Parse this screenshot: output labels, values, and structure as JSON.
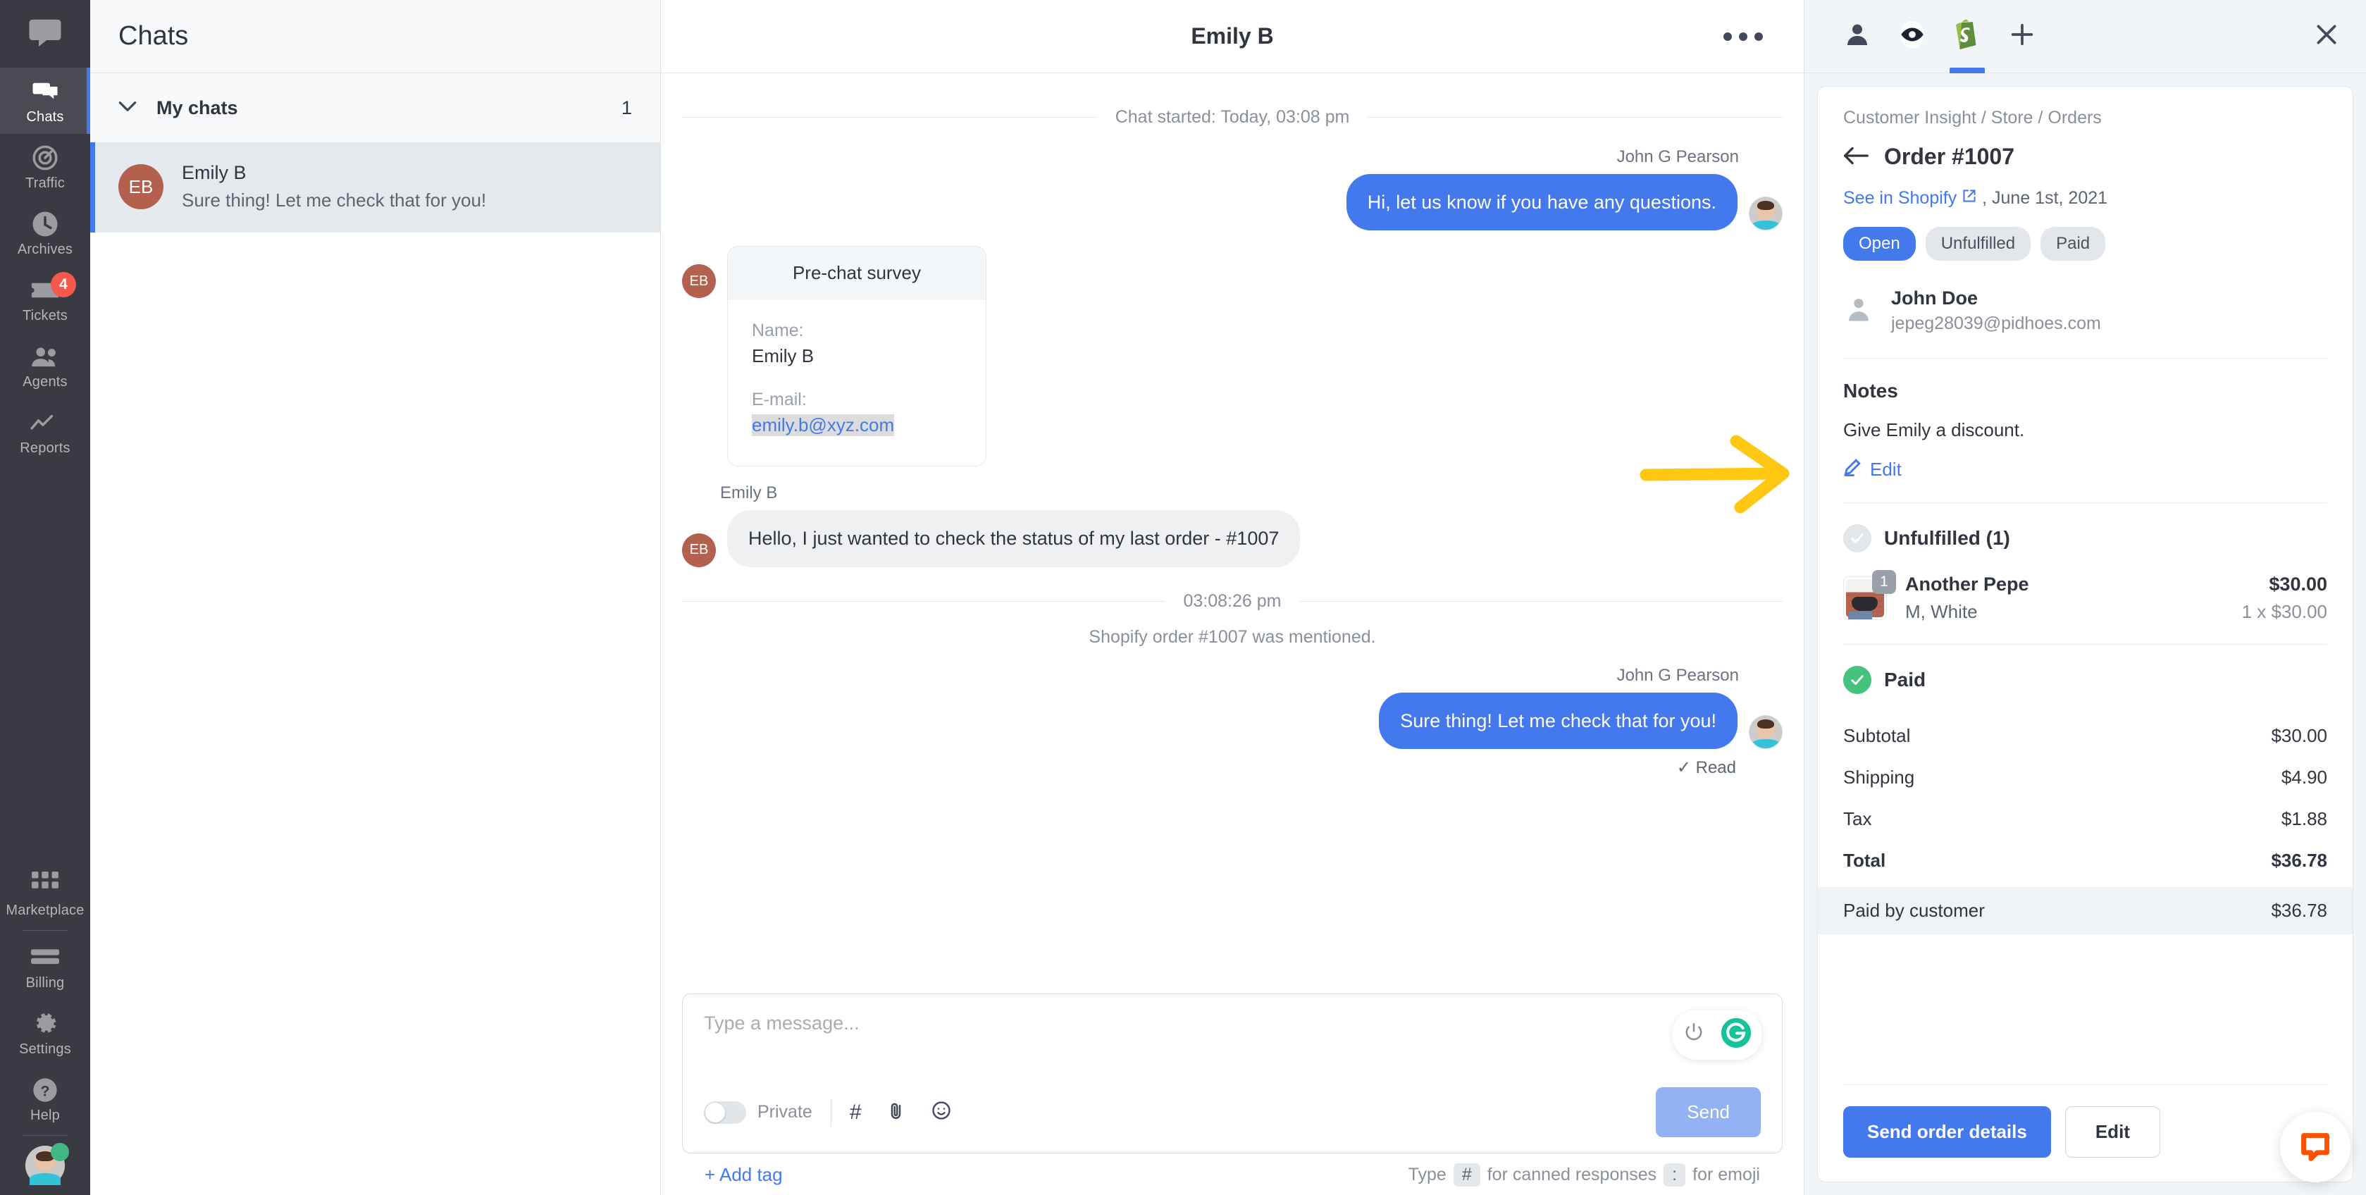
{
  "rail": {
    "logo_icon": "livechat-logo-icon",
    "items": [
      {
        "label": "Chats",
        "icon": "chats-icon",
        "active": true,
        "badge": ""
      },
      {
        "label": "Traffic",
        "icon": "traffic-icon",
        "active": false,
        "badge": ""
      },
      {
        "label": "Archives",
        "icon": "archives-clock-icon",
        "active": false,
        "badge": ""
      },
      {
        "label": "Tickets",
        "icon": "ticket-icon",
        "active": false,
        "badge": "4"
      },
      {
        "label": "Agents",
        "icon": "agents-people-icon",
        "active": false,
        "badge": ""
      },
      {
        "label": "Reports",
        "icon": "reports-chart-icon",
        "active": false,
        "badge": ""
      }
    ],
    "bottom_items": [
      {
        "label": "Marketplace",
        "icon": "marketplace-grid-icon"
      },
      {
        "label": "Billing",
        "icon": "billing-card-icon"
      },
      {
        "label": "Settings",
        "icon": "gear-icon"
      },
      {
        "label": "Help",
        "icon": "help-question-icon"
      }
    ],
    "avatar_name": "agent-avatar",
    "badge_color": "#f4594c",
    "accent_color": "#4379ec"
  },
  "chat_list": {
    "title": "Chats",
    "group_label": "My chats",
    "group_count": "1",
    "rows": [
      {
        "initials": "EB",
        "name": "Emily B",
        "preview": "Sure thing! Let me check that for you!"
      }
    ]
  },
  "conversation": {
    "header_title": "Emily B",
    "start_divider": "Chat started: Today, 03:08 pm",
    "messages": [
      {
        "kind": "bubble",
        "side": "out",
        "author": "John G Pearson",
        "text": "Hi, let us know if you have any questions."
      },
      {
        "kind": "survey",
        "side": "in",
        "initials": "EB",
        "survey_title": "Pre-chat survey",
        "fields": [
          {
            "label": "Name:",
            "value": "Emily B",
            "is_link": false
          },
          {
            "label": "E-mail:",
            "value": "emily.b@xyz.com",
            "is_link": true
          }
        ]
      },
      {
        "kind": "bubble",
        "side": "in",
        "author": "Emily B",
        "initials": "EB",
        "text": "Hello, I just wanted to check the status of my last order - #1007"
      },
      {
        "kind": "divider",
        "text": "03:08:26 pm"
      },
      {
        "kind": "system",
        "text": "Shopify order #1007 was mentioned."
      },
      {
        "kind": "bubble",
        "side": "out",
        "author": "John G Pearson",
        "text": "Sure thing! Let me check that for you!",
        "read_label": "Read"
      }
    ],
    "composer": {
      "placeholder": "Type a message...",
      "private_label": "Private",
      "canned_icon": "hash-icon",
      "attach_icon": "paperclip-icon",
      "emoji_icon": "emoji-smiley-icon",
      "send_label": "Send",
      "power_icon": "power-icon",
      "grammarly_icon": "grammarly-icon"
    },
    "add_tag_label": "+ Add tag",
    "hint": {
      "pre": "Type",
      "key1": "#",
      "mid": "for canned responses",
      "key2": ":",
      "post": "for emoji"
    }
  },
  "right_panel": {
    "tabs": [
      {
        "icon": "customer-person-icon",
        "active": false
      },
      {
        "icon": "visitor-eye-icon",
        "active": false
      },
      {
        "icon": "shopify-bag-icon",
        "active": true
      },
      {
        "icon": "plus-icon",
        "active": false
      }
    ],
    "close_icon": "close-icon",
    "breadcrumb": "Customer Insight / Store / Orders",
    "order_title": "Order #1007",
    "back_icon": "arrow-left-icon",
    "see_in_shopify": "See in Shopify",
    "external_icon": "external-link-icon",
    "order_date": ", June 1st, 2021",
    "chips": [
      {
        "label": "Open",
        "style": "blue"
      },
      {
        "label": "Unfulfilled",
        "style": "grey"
      },
      {
        "label": "Paid",
        "style": "grey"
      }
    ],
    "customer": {
      "name": "John Doe",
      "email": "jepeg28039@pidhoes.com",
      "icon": "person-icon"
    },
    "notes": {
      "heading": "Notes",
      "text": "Give Emily a discount.",
      "edit_label": "Edit",
      "edit_icon": "pencil-icon"
    },
    "fulfillment": {
      "status_label": "Unfulfilled (1)",
      "status_icon": "check-circle-grey-icon",
      "items": [
        {
          "qty": "1",
          "name": "Another Pepe",
          "variant": "M, White",
          "price": "$30.00",
          "calc": "1 x $30.00",
          "thumb": "product-thumbnail"
        }
      ]
    },
    "payment": {
      "status_label": "Paid",
      "status_icon": "check-circle-green-icon",
      "rows": [
        {
          "label": "Subtotal",
          "value": "$30.00",
          "bold": false,
          "hl": false
        },
        {
          "label": "Shipping",
          "value": "$4.90",
          "bold": false,
          "hl": false
        },
        {
          "label": "Tax",
          "value": "$1.88",
          "bold": false,
          "hl": false
        },
        {
          "label": "Total",
          "value": "$36.78",
          "bold": true,
          "hl": false
        },
        {
          "label": "Paid by customer",
          "value": "$36.78",
          "bold": false,
          "hl": true
        }
      ]
    },
    "footer": {
      "primary_label": "Send order details",
      "secondary_label": "Edit"
    },
    "widget_bubble_icon": "livechat-widget-icon"
  },
  "annotation": {
    "arrow_icon": "yellow-arrow-right-icon",
    "arrow_color": "#ffc711"
  }
}
